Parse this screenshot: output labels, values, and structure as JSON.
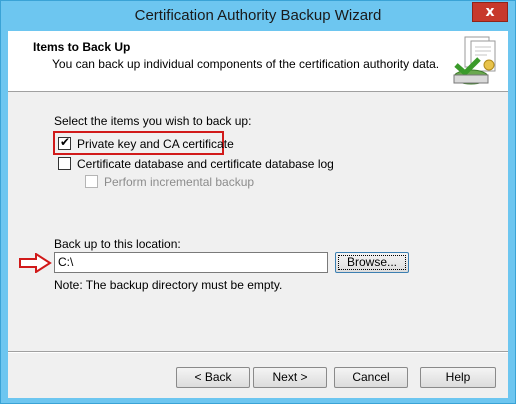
{
  "window": {
    "title": "Certification Authority Backup Wizard",
    "close_label": "x"
  },
  "header": {
    "title": "Items to Back Up",
    "subtitle": "You can back up individual components of the certification authority data."
  },
  "body": {
    "select_prompt": "Select the items you wish to back up:",
    "options": [
      {
        "label": "Private key and CA certificate",
        "checked": true,
        "enabled": true
      },
      {
        "label": "Certificate database and certificate database log",
        "checked": false,
        "enabled": true
      },
      {
        "label": "Perform incremental backup",
        "checked": false,
        "enabled": false
      }
    ],
    "location_label": "Back up to this location:",
    "location_value": "C:\\",
    "browse_label": "Browse...",
    "note": "Note: The backup directory must be empty."
  },
  "footer": {
    "back_label": "< Back",
    "next_label": "Next >",
    "cancel_label": "Cancel",
    "help_label": "Help"
  },
  "colors": {
    "frame": "#6dc6f0",
    "close": "#c7392b",
    "annotation": "#d11a1a"
  }
}
